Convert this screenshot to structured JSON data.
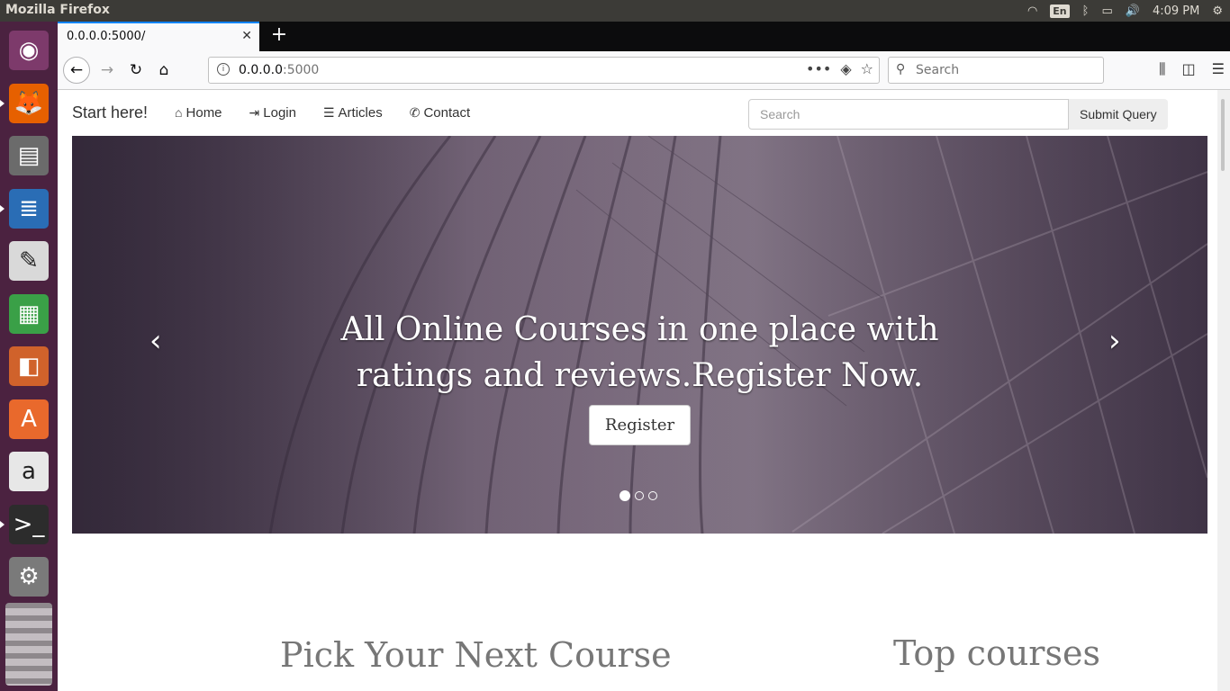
{
  "system": {
    "window_title": "Mozilla Firefox",
    "lang": "En",
    "clock": "4:09 PM"
  },
  "launcher": {
    "items": [
      {
        "name": "ubuntu-dash-icon",
        "glyph": "◉",
        "bg": "#7d3a6b"
      },
      {
        "name": "firefox-icon",
        "glyph": "🦊",
        "bg": "#e66000"
      },
      {
        "name": "files-icon",
        "glyph": "▤",
        "bg": "#6b6b6b"
      },
      {
        "name": "writer-icon",
        "glyph": "≣",
        "bg": "#2a6db5"
      },
      {
        "name": "document-viewer-icon",
        "glyph": "✎",
        "bg": "#d9d9d9"
      },
      {
        "name": "calc-icon",
        "glyph": "▦",
        "bg": "#3aa047"
      },
      {
        "name": "impress-icon",
        "glyph": "◧",
        "bg": "#d0622b"
      },
      {
        "name": "software-center-icon",
        "glyph": "A",
        "bg": "#e9692c"
      },
      {
        "name": "amazon-icon",
        "glyph": "a",
        "bg": "#e7e7e7"
      },
      {
        "name": "terminal-icon",
        "glyph": ">_",
        "bg": "#2c2c2c"
      },
      {
        "name": "settings-icon",
        "glyph": "⚙",
        "bg": "#7a7a7a"
      }
    ]
  },
  "browser": {
    "tab_title": "0.0.0.0:5000/",
    "url_host": "0.0.0.0",
    "url_port": ":5000",
    "search_placeholder": "Search"
  },
  "site": {
    "brand": "Start here!",
    "nav": [
      {
        "label": "Home",
        "icon": "home-icon",
        "glyph": "⌂"
      },
      {
        "label": "Login",
        "icon": "login-icon",
        "glyph": "⇥"
      },
      {
        "label": "Articles",
        "icon": "list-icon",
        "glyph": "☰"
      },
      {
        "label": "Contact",
        "icon": "phone-icon",
        "glyph": "✆"
      }
    ],
    "search_placeholder": "Search",
    "search_button": "Submit Query",
    "carousel": {
      "caption_line1": "All Online Courses in one place with",
      "caption_line2": "ratings and reviews.Register Now.",
      "button": "Register",
      "active_slide": 1,
      "slide_count": 3
    },
    "section_left_title": "Pick Your Next Course",
    "section_right_title": "Top courses"
  }
}
